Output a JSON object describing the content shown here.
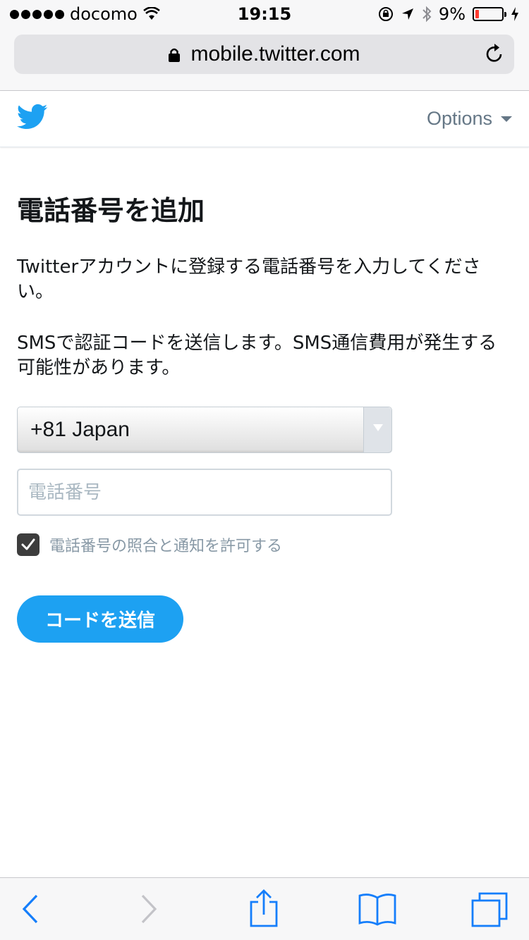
{
  "status_bar": {
    "carrier": "docomo",
    "time": "19:15",
    "battery_percent": "9%",
    "battery_level": 0.09,
    "colors": {
      "battery_low": "#ff3b30"
    }
  },
  "browser": {
    "url": "mobile.twitter.com",
    "icons": {
      "lock": "lock-icon",
      "reload": "reload-icon",
      "back": "back-chevron-icon",
      "forward": "forward-chevron-icon",
      "share": "share-icon",
      "bookmarks": "bookmarks-book-icon",
      "tabs": "tabs-icon"
    }
  },
  "header": {
    "logo": "twitter-bird-icon",
    "options_label": "Options",
    "colors": {
      "brand": "#1da1f2"
    }
  },
  "main": {
    "title": "電話番号を追加",
    "description_1": "Twitterアカウントに登録する電話番号を入力してください。",
    "description_2": "SMSで認証コードを送信します。SMS通信費用が発生する可能性があります。",
    "country_select": {
      "value": "+81 Japan"
    },
    "phone_field": {
      "placeholder": "電話番号",
      "value": ""
    },
    "consent_checkbox": {
      "checked": true,
      "label": "電話番号の照合と通知を許可する"
    },
    "submit_label": "コードを送信"
  }
}
